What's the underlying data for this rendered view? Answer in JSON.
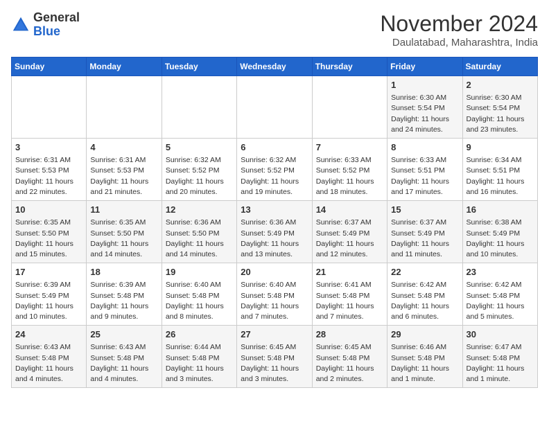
{
  "header": {
    "logo": {
      "general": "General",
      "blue": "Blue"
    },
    "month_year": "November 2024",
    "location": "Daulatabad, Maharashtra, India"
  },
  "calendar": {
    "weekdays": [
      "Sunday",
      "Monday",
      "Tuesday",
      "Wednesday",
      "Thursday",
      "Friday",
      "Saturday"
    ],
    "weeks": [
      [
        {
          "day": "",
          "info": ""
        },
        {
          "day": "",
          "info": ""
        },
        {
          "day": "",
          "info": ""
        },
        {
          "day": "",
          "info": ""
        },
        {
          "day": "",
          "info": ""
        },
        {
          "day": "1",
          "info": "Sunrise: 6:30 AM\nSunset: 5:54 PM\nDaylight: 11 hours\nand 24 minutes."
        },
        {
          "day": "2",
          "info": "Sunrise: 6:30 AM\nSunset: 5:54 PM\nDaylight: 11 hours\nand 23 minutes."
        }
      ],
      [
        {
          "day": "3",
          "info": "Sunrise: 6:31 AM\nSunset: 5:53 PM\nDaylight: 11 hours\nand 22 minutes."
        },
        {
          "day": "4",
          "info": "Sunrise: 6:31 AM\nSunset: 5:53 PM\nDaylight: 11 hours\nand 21 minutes."
        },
        {
          "day": "5",
          "info": "Sunrise: 6:32 AM\nSunset: 5:52 PM\nDaylight: 11 hours\nand 20 minutes."
        },
        {
          "day": "6",
          "info": "Sunrise: 6:32 AM\nSunset: 5:52 PM\nDaylight: 11 hours\nand 19 minutes."
        },
        {
          "day": "7",
          "info": "Sunrise: 6:33 AM\nSunset: 5:52 PM\nDaylight: 11 hours\nand 18 minutes."
        },
        {
          "day": "8",
          "info": "Sunrise: 6:33 AM\nSunset: 5:51 PM\nDaylight: 11 hours\nand 17 minutes."
        },
        {
          "day": "9",
          "info": "Sunrise: 6:34 AM\nSunset: 5:51 PM\nDaylight: 11 hours\nand 16 minutes."
        }
      ],
      [
        {
          "day": "10",
          "info": "Sunrise: 6:35 AM\nSunset: 5:50 PM\nDaylight: 11 hours\nand 15 minutes."
        },
        {
          "day": "11",
          "info": "Sunrise: 6:35 AM\nSunset: 5:50 PM\nDaylight: 11 hours\nand 14 minutes."
        },
        {
          "day": "12",
          "info": "Sunrise: 6:36 AM\nSunset: 5:50 PM\nDaylight: 11 hours\nand 14 minutes."
        },
        {
          "day": "13",
          "info": "Sunrise: 6:36 AM\nSunset: 5:49 PM\nDaylight: 11 hours\nand 13 minutes."
        },
        {
          "day": "14",
          "info": "Sunrise: 6:37 AM\nSunset: 5:49 PM\nDaylight: 11 hours\nand 12 minutes."
        },
        {
          "day": "15",
          "info": "Sunrise: 6:37 AM\nSunset: 5:49 PM\nDaylight: 11 hours\nand 11 minutes."
        },
        {
          "day": "16",
          "info": "Sunrise: 6:38 AM\nSunset: 5:49 PM\nDaylight: 11 hours\nand 10 minutes."
        }
      ],
      [
        {
          "day": "17",
          "info": "Sunrise: 6:39 AM\nSunset: 5:49 PM\nDaylight: 11 hours\nand 10 minutes."
        },
        {
          "day": "18",
          "info": "Sunrise: 6:39 AM\nSunset: 5:48 PM\nDaylight: 11 hours\nand 9 minutes."
        },
        {
          "day": "19",
          "info": "Sunrise: 6:40 AM\nSunset: 5:48 PM\nDaylight: 11 hours\nand 8 minutes."
        },
        {
          "day": "20",
          "info": "Sunrise: 6:40 AM\nSunset: 5:48 PM\nDaylight: 11 hours\nand 7 minutes."
        },
        {
          "day": "21",
          "info": "Sunrise: 6:41 AM\nSunset: 5:48 PM\nDaylight: 11 hours\nand 7 minutes."
        },
        {
          "day": "22",
          "info": "Sunrise: 6:42 AM\nSunset: 5:48 PM\nDaylight: 11 hours\nand 6 minutes."
        },
        {
          "day": "23",
          "info": "Sunrise: 6:42 AM\nSunset: 5:48 PM\nDaylight: 11 hours\nand 5 minutes."
        }
      ],
      [
        {
          "day": "24",
          "info": "Sunrise: 6:43 AM\nSunset: 5:48 PM\nDaylight: 11 hours\nand 4 minutes."
        },
        {
          "day": "25",
          "info": "Sunrise: 6:43 AM\nSunset: 5:48 PM\nDaylight: 11 hours\nand 4 minutes."
        },
        {
          "day": "26",
          "info": "Sunrise: 6:44 AM\nSunset: 5:48 PM\nDaylight: 11 hours\nand 3 minutes."
        },
        {
          "day": "27",
          "info": "Sunrise: 6:45 AM\nSunset: 5:48 PM\nDaylight: 11 hours\nand 3 minutes."
        },
        {
          "day": "28",
          "info": "Sunrise: 6:45 AM\nSunset: 5:48 PM\nDaylight: 11 hours\nand 2 minutes."
        },
        {
          "day": "29",
          "info": "Sunrise: 6:46 AM\nSunset: 5:48 PM\nDaylight: 11 hours\nand 1 minute."
        },
        {
          "day": "30",
          "info": "Sunrise: 6:47 AM\nSunset: 5:48 PM\nDaylight: 11 hours\nand 1 minute."
        }
      ]
    ]
  }
}
